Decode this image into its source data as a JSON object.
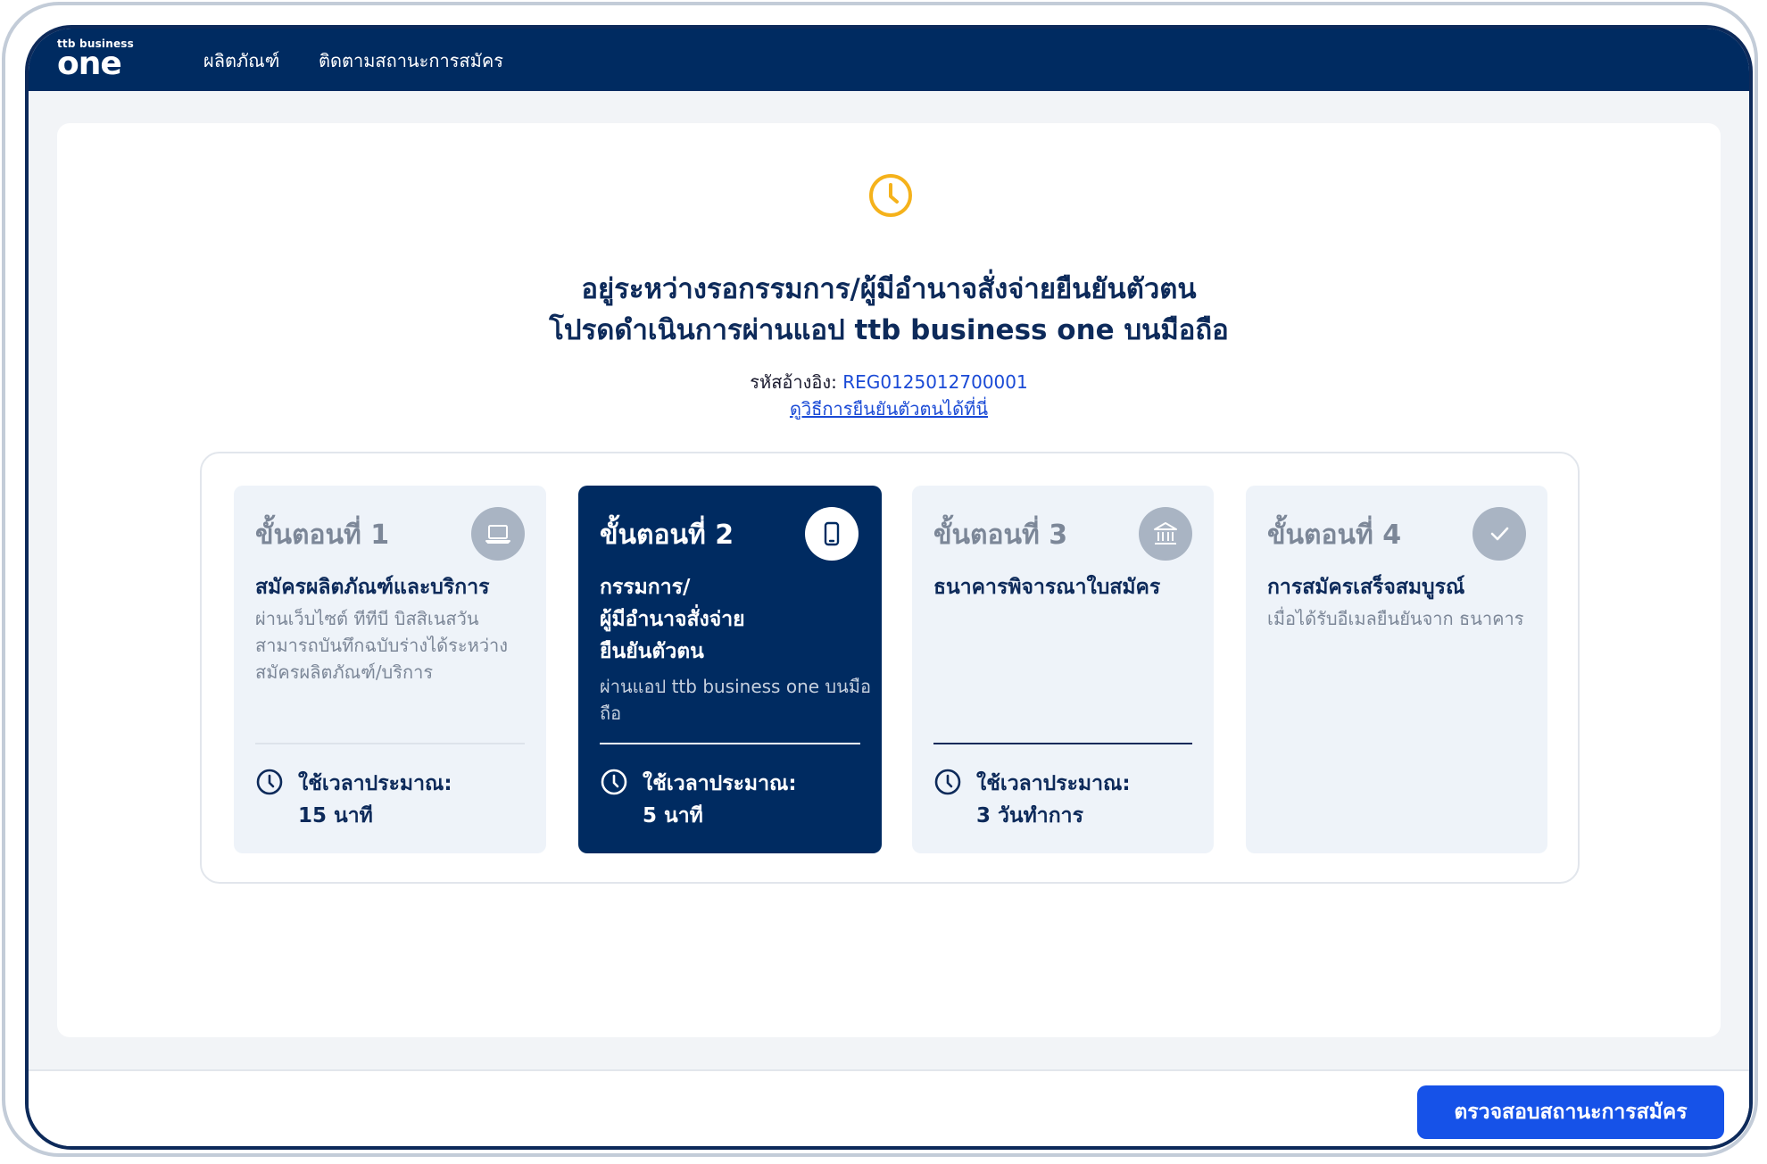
{
  "brand": {
    "small": "ttb business",
    "big": "one"
  },
  "nav": {
    "items": [
      {
        "label": "ผลิตภัณฑ์"
      },
      {
        "label": "ติดตามสถานะการสมัคร"
      }
    ]
  },
  "status": {
    "title_line1": "อยู่ระหว่างรอกรรมการ/ผู้มีอำนาจสั่งจ่ายยืนยันตัวตน",
    "title_line2": "โปรดดำเนินการผ่านแอป ttb business one บนมือถือ",
    "ref_label": "รหัสอ้างอิง:",
    "ref_code": "REG0125012700001",
    "howto_link": "ดูวิธีการยืนยันตัวตนได้ที่นี่",
    "accent_color": "#f5b21b"
  },
  "steps": [
    {
      "heading": "ขั้นตอนที่ 1",
      "icon": "laptop-icon",
      "title": "สมัครผลิตภัณฑ์และบริการ",
      "desc": "ผ่านเว็บไซต์ ทีทีบี บิสสิเนสวัน สามารถบันทึกฉบับร่างได้ระหว่าง สมัครผลิตภัณฑ์/บริการ",
      "time_label": "ใช้เวลาประมาณ:",
      "time_value": "15 นาที",
      "state": "done"
    },
    {
      "heading": "ขั้นตอนที่ 2",
      "icon": "mobile-phone-icon",
      "title": "กรรมการ/ผู้มีอำนาจสั่งจ่าย ยืนยันตัวตน",
      "title_lines": [
        "กรรมการ/",
        "ผู้มีอำนาจสั่งจ่าย",
        "ยืนยันตัวตน"
      ],
      "desc": "ผ่านแอป ttb business one บนมือถือ",
      "time_label": "ใช้เวลาประมาณ:",
      "time_value": "5 นาที",
      "state": "active"
    },
    {
      "heading": "ขั้นตอนที่ 3",
      "icon": "bank-icon",
      "title": "ธนาคารพิจารณาใบสมัคร",
      "desc": "",
      "time_label": "ใช้เวลาประมาณ:",
      "time_value": "3 วันทำการ",
      "state": "pending"
    },
    {
      "heading": "ขั้นตอนที่ 4",
      "icon": "check-icon",
      "title": "การสมัครเสร็จสมบูรณ์",
      "desc": "เมื่อได้รับอีเมลยืนยันจาก ธนาคาร",
      "state": "pending"
    }
  ],
  "footer": {
    "cta_label": "ตรวจสอบสถานะการสมัคร"
  },
  "colors": {
    "navy": "#002b61",
    "primary_blue": "#1652e8",
    "link_blue": "#1a4ad6",
    "inactive_badge": "#a9b4c3"
  }
}
